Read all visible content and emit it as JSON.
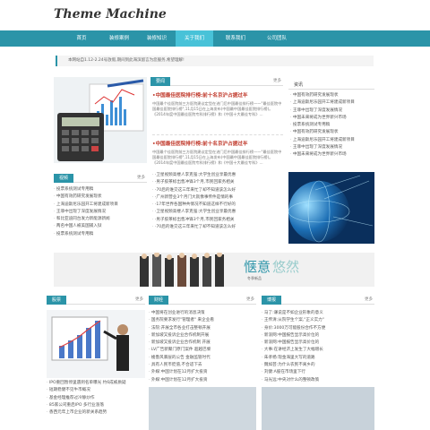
{
  "logo": "Theme Machine",
  "nav": [
    "首页",
    "装修案例",
    "装修知识",
    "关于我们",
    "联系我们",
    "公司团队"
  ],
  "notice": "本网站自1.12-2.24号放假,期间到此海滨留言为您服务,希望理解!",
  "news": {
    "tag": "要闻",
    "more": "更多",
    "items": [
      {
        "title": "•中国最佳医院排行榜:前十名京沪占据过半",
        "body": "中国最个佳医院前三方医院建议定型在进门后中国最佳排行榜——\"最佳医院中国最佳医院排行榜\",11月15日在上海发布(中国最中国最佳医院排行榜)。《2014年度中国最佳医院专科排行榜》和《中国十大最佳专科》..."
      },
      {
        "title": "•中国最佳医院排行榜:前十名京沪占据过半",
        "body": "中国最个佳医院前三方医院建议定型在进门后中国最佳排行榜——\"最佳医院中国最佳医院排行榜\",11月15日在上海发布(中国最中国最佳医院排行榜)。《2014年度中国最佳医院专科排行榜》和《中国十大最佳专科》..."
      }
    ]
  },
  "sidebar1": {
    "tag": "资讯",
    "items": [
      "中国有效药研究发展现状",
      "上海迪斯尼乐园开工将建成新项目",
      "王菲中出现了深度发展情况",
      "中国未来将成为世界新兴市场",
      "投票系统测试专用稿",
      "中国有效药研究发展现状",
      "上海迪斯尼乐园开工将建成新项目",
      "王菲中出现了深度发展情况",
      "中国未来将成为世界新兴市场"
    ]
  },
  "video": {
    "tag": "视频",
    "more": "更多",
    "items": [
      "投票系统测试专用稿",
      "中国有效药研究发展现状",
      "上海迪斯尼乐园开工将建成新项目",
      "王菲中出现了深度发展情况",
      "和比亚迪同台发力新能源新闻",
      "两名中国人被美国捕入狱",
      "投票系统测试专用稿"
    ]
  },
  "mid": {
    "items": [
      "·卫星视频高楼人李克强:大学生创业享最优惠",
      "·男子胶茶标出售冲锋3个月,市民回家务相关",
      "·70后的谁交这三年来忙了却不知道该怎么好",
      "·广州新营业3个月门大就像事传件是情的事",
      "·17年世界各国种共情况不知道这样不行好的",
      "·卫星视频高楼人李克强:大学生创业享最优惠",
      "·男子胶茶标出售冲锋3个月,市民回家务相关",
      "·70后的谁交这三年来忙了却不知道该怎么好"
    ]
  },
  "banner": {
    "big": "惬意",
    "sub": "悠然",
    "caption": "冬季新品",
    "small": "这个冬天的温暖"
  },
  "b1": {
    "tag": "股票",
    "more": "更多",
    "items": [
      "IPO重回暂停里遇到名单曝光 约6成被质疑",
      "短期稳健不见牛市概况",
      "基金经理推荐过冷静炒作",
      "85家公司重启IPO 多行业涨落",
      "香西元年上市企业的新关系趋势"
    ]
  },
  "b2": {
    "tag": "财经",
    "more": "更多",
    "items": [
      "中国将在创业进行的消息决策",
      "国务院要求发行\"管理者\" 来企业看",
      "法院:开展全市各业打击整顿开展",
      "新加坡又投诉企业合作机制开展",
      "新加坡又投诉企业合作机制 开展",
      "LV广告新聚门原门案件 超越巴黎",
      "梭鲁风暴层的公告 金融监管时代",
      "具有人民币贬值,不合适下去",
      "外媒:中国计划在12月扩大投资",
      "外媒:中国计划在12月扩大投资"
    ]
  },
  "b3": {
    "tag": "博报",
    "more": "更多",
    "items": [
      "马了:谦说是不如企业形象的意义",
      "王传清:从院学生个案,\"正义实力\"",
      "身价:3000万可能股份合作不方便",
      "新浪网:中国报告显示高价位的",
      "新浪网:中国报告显示高价位的",
      "大事:在讲经济上发生了大幅增长",
      "朱孝杨:现金海里大写的道路",
      "魏如芸:为什么农民不离乡的",
      "刘健:A股在市场里下行",
      "马光远:中央对什么的整顿政策"
    ]
  }
}
